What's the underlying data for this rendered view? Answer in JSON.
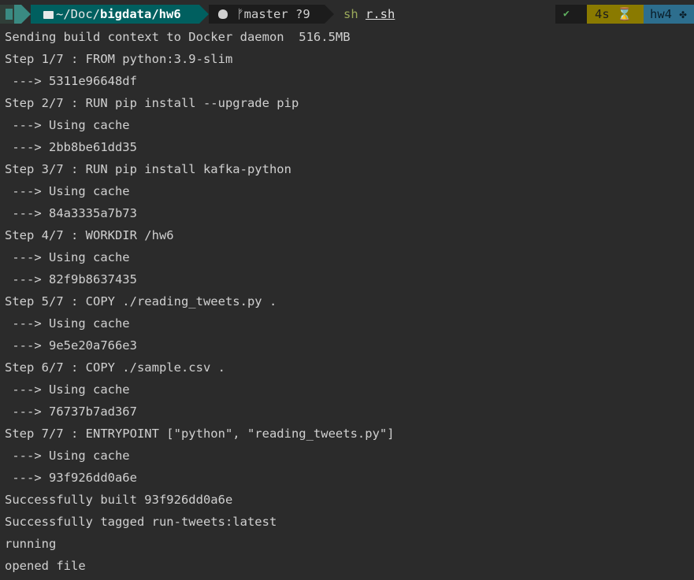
{
  "prompt": {
    "os_icon": "terminal-icon",
    "folder_icon": "folder-open-icon",
    "path_prefix": "~/Doc/",
    "path_mid": "bigdata/",
    "path_current": "hw6",
    "git_icon": "github-octocat-icon",
    "branch_icon": "git-branch-icon",
    "branch": "master",
    "git_status": "?9",
    "command": "sh",
    "command_arg": "r.sh",
    "status_ok": "✔",
    "duration": "4s",
    "duration_icon": "hourglass-icon",
    "host": "hw4",
    "host_icon": "gear-icon"
  },
  "colors": {
    "background": "#2b2b2b",
    "text": "#d0d0d0",
    "dir_segment": "#005f5f",
    "git_segment": "#1c1c1c",
    "time_segment": "#8a7a00",
    "host_segment": "#2d6e8e",
    "ok_check": "#5faf5f",
    "command": "#9aa85a"
  },
  "output": [
    "Sending build context to Docker daemon  516.5MB",
    "Step 1/7 : FROM python:3.9-slim",
    " ---> 5311e96648df",
    "Step 2/7 : RUN pip install --upgrade pip",
    " ---> Using cache",
    " ---> 2bb8be61dd35",
    "Step 3/7 : RUN pip install kafka-python",
    " ---> Using cache",
    " ---> 84a3335a7b73",
    "Step 4/7 : WORKDIR /hw6",
    " ---> Using cache",
    " ---> 82f9b8637435",
    "Step 5/7 : COPY ./reading_tweets.py .",
    " ---> Using cache",
    " ---> 9e5e20a766e3",
    "Step 6/7 : COPY ./sample.csv .",
    " ---> Using cache",
    " ---> 76737b7ad367",
    "Step 7/7 : ENTRYPOINT [\"python\", \"reading_tweets.py\"]",
    " ---> Using cache",
    " ---> 93f926dd0a6e",
    "Successfully built 93f926dd0a6e",
    "Successfully tagged run-tweets:latest",
    "running",
    "opened file"
  ]
}
